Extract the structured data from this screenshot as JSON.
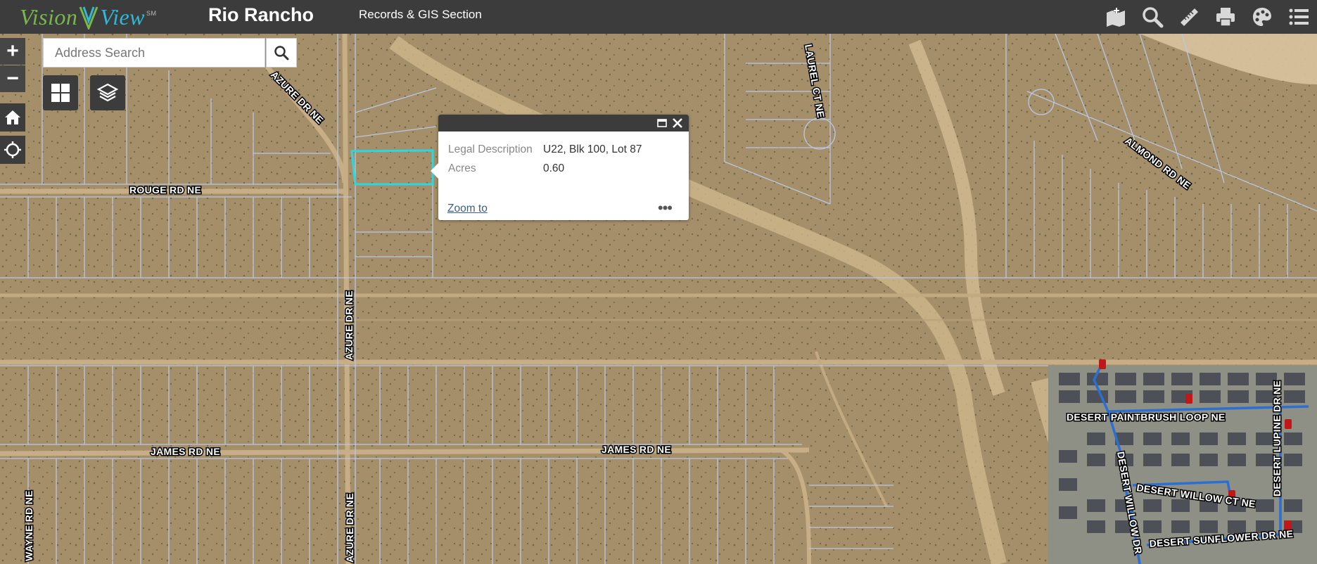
{
  "header": {
    "logo_vision": "Vision",
    "logo_view": "View",
    "logo_sm": "SM",
    "city": "Rio Rancho",
    "section": "Records & GIS Section"
  },
  "toolbar": {
    "icons": [
      "add-data-icon",
      "search-icon",
      "measure-icon",
      "print-icon",
      "basemap-icon",
      "layer-list-icon"
    ]
  },
  "controls": {
    "zoom_in": "+",
    "zoom_out": "−"
  },
  "search": {
    "placeholder": "Address Search"
  },
  "popup": {
    "rows": [
      {
        "label": "Legal Description",
        "value": "U22, Blk 100, Lot 87"
      },
      {
        "label": "Acres",
        "value": "0.60"
      }
    ],
    "zoom_link": "Zoom to",
    "more": "•••"
  },
  "map": {
    "road_labels": [
      "ROUGE RD NE",
      "AZURE DR NE",
      "AZURE DR NE",
      "AZURE DR NE",
      "LAUREL CT NE",
      "ALMOND RD NE",
      "JAMES RD NE",
      "JAMES RD NE",
      "DESERT PAINTBRUSH LOOP NE",
      "DESERT LUPINE DR NE",
      "DESERT WILLOW CT NE",
      "DESERT WILLOW DR",
      "DESERT SUNFLOWER DR NE",
      "WAYNE RD NE"
    ],
    "colors": {
      "ground": "#a58f6a",
      "parcel_lines": "#b9c7e3",
      "selected_parcel": "#29d8e0",
      "water_lines": "#2a6fd1"
    }
  }
}
